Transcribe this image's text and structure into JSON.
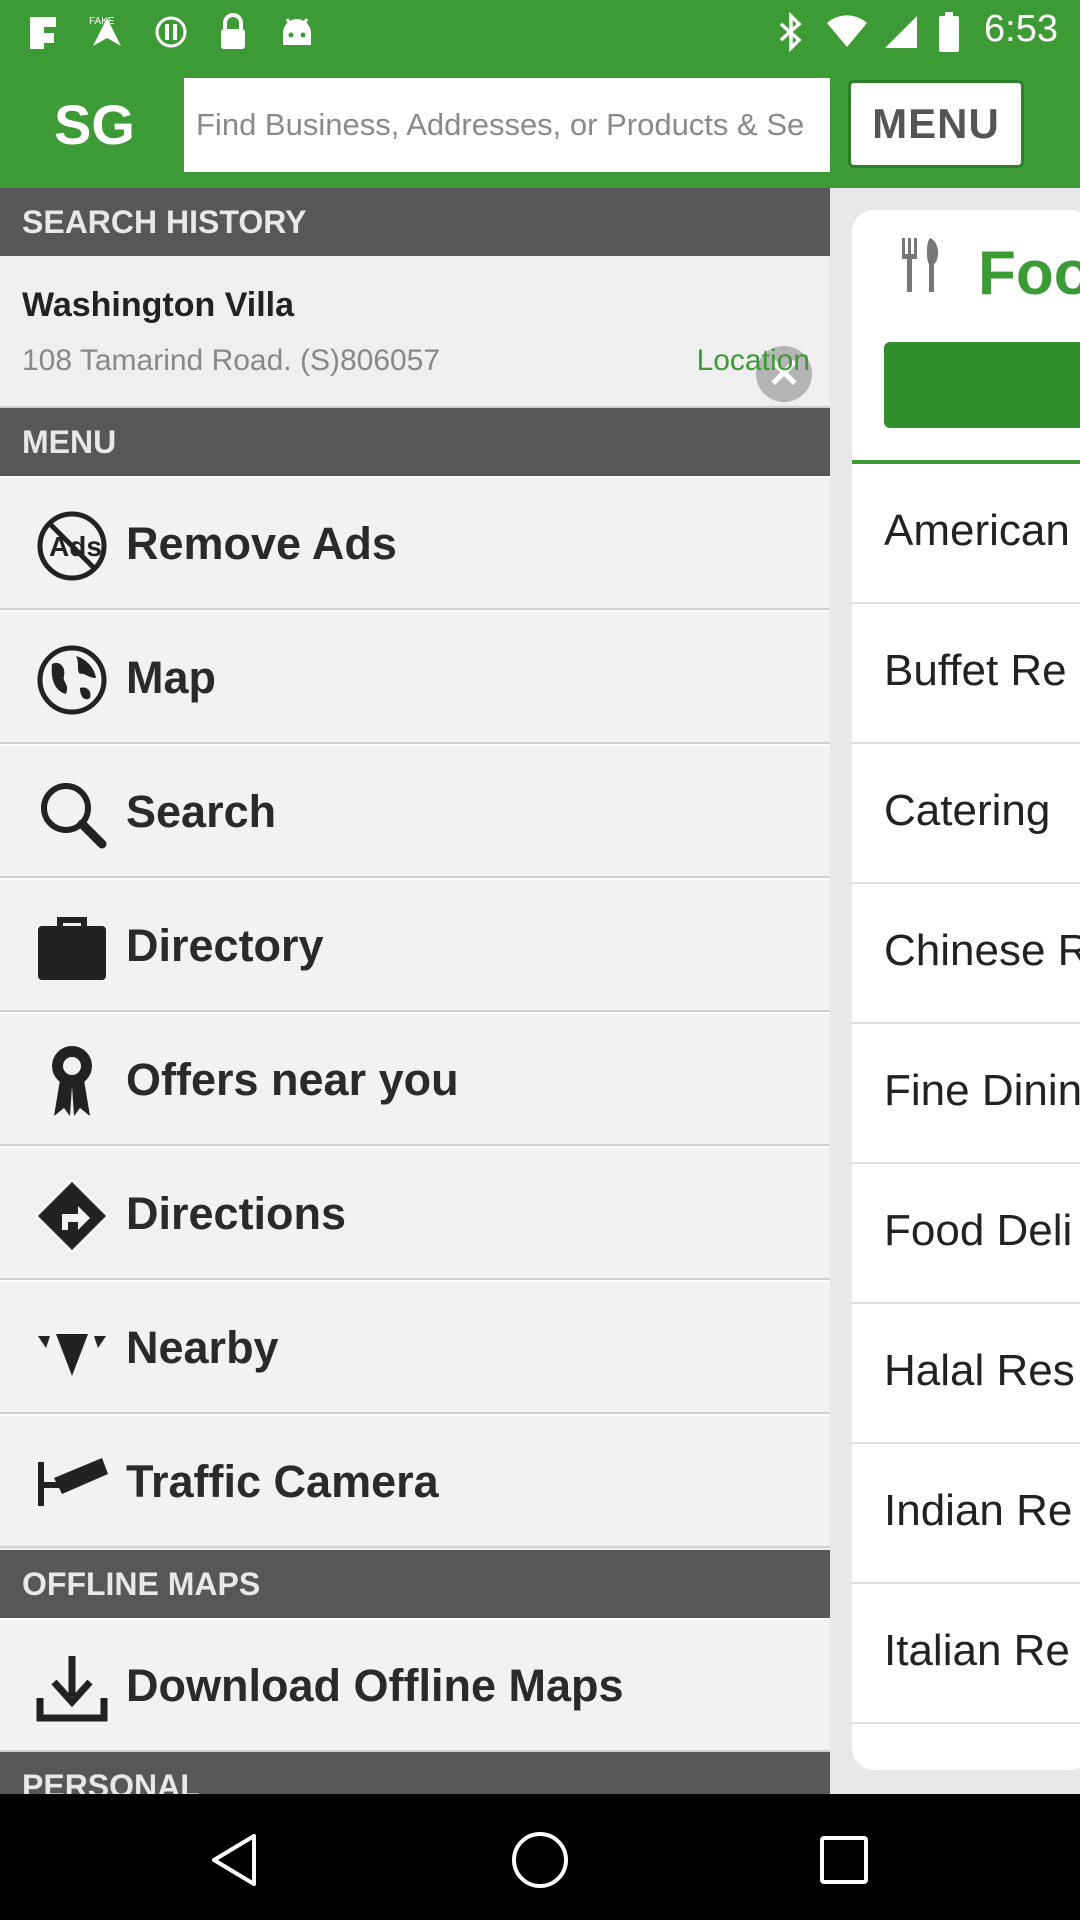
{
  "status_bar": {
    "time": "6:53",
    "icons": [
      "notification-icon",
      "fake-gps-icon",
      "sync-icon",
      "lock-icon",
      "android-icon",
      "bluetooth-icon",
      "wifi-icon",
      "signal-icon",
      "battery-icon"
    ]
  },
  "app_bar": {
    "logo": "SG",
    "search_placeholder": "Find Business, Addresses, or Products & Se",
    "menu_label": "MENU"
  },
  "drawer": {
    "search_history_header": "SEARCH HISTORY",
    "history": {
      "name": "Washington Villa",
      "address": "108 Tamarind Road. (S)806057",
      "action": "Location"
    },
    "menu_header": "MENU",
    "menu_items": [
      {
        "label": "Remove Ads",
        "icon": "no-ads-icon"
      },
      {
        "label": "Map",
        "icon": "globe-icon"
      },
      {
        "label": "Search",
        "icon": "search-icon"
      },
      {
        "label": "Directory",
        "icon": "briefcase-icon"
      },
      {
        "label": "Offers near you",
        "icon": "award-ribbon-icon"
      },
      {
        "label": "Directions",
        "icon": "directions-sign-icon"
      },
      {
        "label": "Nearby",
        "icon": "nearby-icon"
      },
      {
        "label": "Traffic Camera",
        "icon": "traffic-camera-icon"
      }
    ],
    "offline_header": "OFFLINE MAPS",
    "offline_items": [
      {
        "label": "Download Offline Maps",
        "icon": "download-icon"
      }
    ],
    "personal_header": "PERSONAL"
  },
  "background_page": {
    "title": "Foo",
    "categories": [
      "American",
      "Buffet Re",
      "Catering",
      "Chinese R",
      "Fine Dinin",
      "Food Deli",
      "Halal Res",
      "Indian Re",
      "Italian Re"
    ]
  },
  "colors": {
    "brand_green": "#3d9b35",
    "section_header": "#575757"
  }
}
